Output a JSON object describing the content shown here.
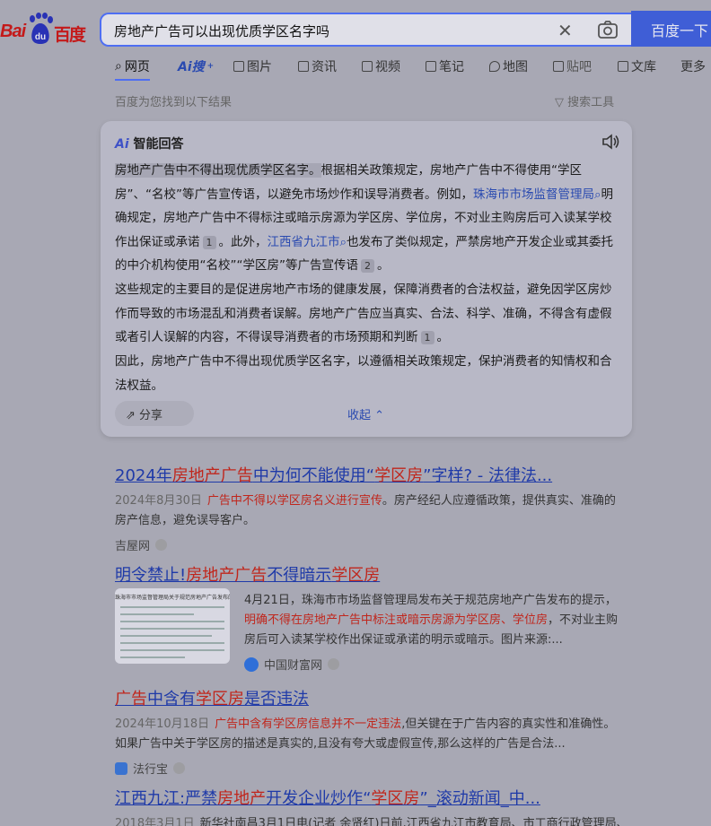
{
  "logo": {
    "text": "Baidu百度",
    "bai": "Bai",
    "du": "du",
    "cn": "百度"
  },
  "search": {
    "query": "房地产广告可以出现优质学区名字吗",
    "button_label": "百度一下",
    "clear_icon": "close-icon",
    "camera_icon": "camera-icon"
  },
  "tabs": [
    {
      "label": "网页",
      "icon": "search-icon"
    },
    {
      "label": "Ai搜",
      "icon": "ai-icon"
    },
    {
      "label": "图片",
      "icon": "image-icon"
    },
    {
      "label": "资讯",
      "icon": "news-icon"
    },
    {
      "label": "视频",
      "icon": "video-icon"
    },
    {
      "label": "笔记",
      "icon": "note-icon"
    },
    {
      "label": "地图",
      "icon": "map-icon"
    },
    {
      "label": "贴吧",
      "icon": "tieba-icon"
    },
    {
      "label": "文库",
      "icon": "doc-icon"
    },
    {
      "label": "更多",
      "icon": ""
    }
  ],
  "found_text": "百度为您找到以下结果",
  "search_tools": "搜索工具",
  "ai_answer": {
    "title_mark": "Ai",
    "title": "智能回答",
    "p1": [
      {
        "text": "房地产广告中不得出现优质学区名字。",
        "hl": true
      },
      {
        "text": "根据相关政策规定，房地产广告中不得使用“学区房”、“名校”等广告宣传语，以避免市场炒作和误导消费者。例如，"
      },
      {
        "text": "珠海市市场监督管理局",
        "link": true
      },
      {
        "text": "明确规定，房地产广告中不得标注或暗示房源为学区房、学位房，不对业主购房后可入读某学校作出保证或承诺"
      },
      {
        "num": "1"
      },
      {
        "text": "。此外，"
      },
      {
        "text": "江西省九江市",
        "link": true
      },
      {
        "text": "也发布了类似规定，严禁房地产开发企业或其委托的中介机构使用“名校”“学区房”等广告宣传语"
      },
      {
        "num": "2"
      },
      {
        "text": "。"
      }
    ],
    "p2": "这些规定的主要目的是促进房地产市场的健康发展，保障消费者的合法权益，避免因学区房炒作而导致的市场混乱和消费者误解。房地产广告应当真实、合法、科学、准确，不得含有虚假或者引人误解的内容，不得误导消费者的市场预期和判断",
    "p2_num": "1",
    "p2_end": "。",
    "p3": "因此，房地产广告中不得出现优质学区名字，以遵循相关政策规定，保护消费者的知情权和合法权益。",
    "share": "分享",
    "collapse": "收起"
  },
  "results": [
    {
      "title": [
        {
          "t": "2024年"
        },
        {
          "t": "房地产广告",
          "em": true
        },
        {
          "t": "中为何不能使用“"
        },
        {
          "t": "学区房",
          "em": true
        },
        {
          "t": "”字样? - 法律法..."
        }
      ],
      "date": "2024年8月30日",
      "desc": [
        {
          "t": "广告中不得以学区房名义进行宣传",
          "em": true
        },
        {
          "t": "。房产经纪人应遵循政策，提供真实、准确的房产信息，避免误导客户。"
        }
      ],
      "source": "吉屋网"
    },
    {
      "title": [
        {
          "t": "明令禁止!"
        },
        {
          "t": "房地产广告",
          "em": true
        },
        {
          "t": "不得暗示"
        },
        {
          "t": "学区房",
          "em": true
        }
      ],
      "date": "4月21日",
      "desc": [
        {
          "t": "，珠海市市场监督管理局发布关于规范房地产广告发布的提示，"
        },
        {
          "t": "明确不得在房地产广告中标注或暗示房源为学区房、学位房",
          "em": true
        },
        {
          "t": "，不对业主购房后可入读某学校作出保证或承诺的明示或暗示。图片来源:..."
        }
      ],
      "thumb_title": "珠海市市场监督管理局关于规范房地产广告发布的提示",
      "source": "中国财富网"
    },
    {
      "title": [
        {
          "t": "广告",
          "em": true
        },
        {
          "t": "中含有"
        },
        {
          "t": "学区房",
          "em": true
        },
        {
          "t": "是否违法"
        }
      ],
      "date": "2024年10月18日",
      "desc": [
        {
          "t": "广告中含有学区房信息并不一定违法",
          "em": true
        },
        {
          "t": ",但关键在于广告内容的真实性和准确性。如果广告中关于学区房的描述是真实的,且没有夸大或虚假宣传,那么这样的广告是合法..."
        }
      ],
      "source": "法行宝"
    },
    {
      "title": [
        {
          "t": "江西九江:严禁"
        },
        {
          "t": "房地产",
          "em": true
        },
        {
          "t": "开发企业炒作“"
        },
        {
          "t": "学区房",
          "em": true
        },
        {
          "t": "”_滚动新闻_中..."
        }
      ],
      "date": "2018年3月1日",
      "desc": [
        {
          "t": "新华社南昌3月1日电(记者 余贤红)日前,江西省九江市教育局、市工商行政管理局、"
        }
      ],
      "source": ""
    }
  ]
}
